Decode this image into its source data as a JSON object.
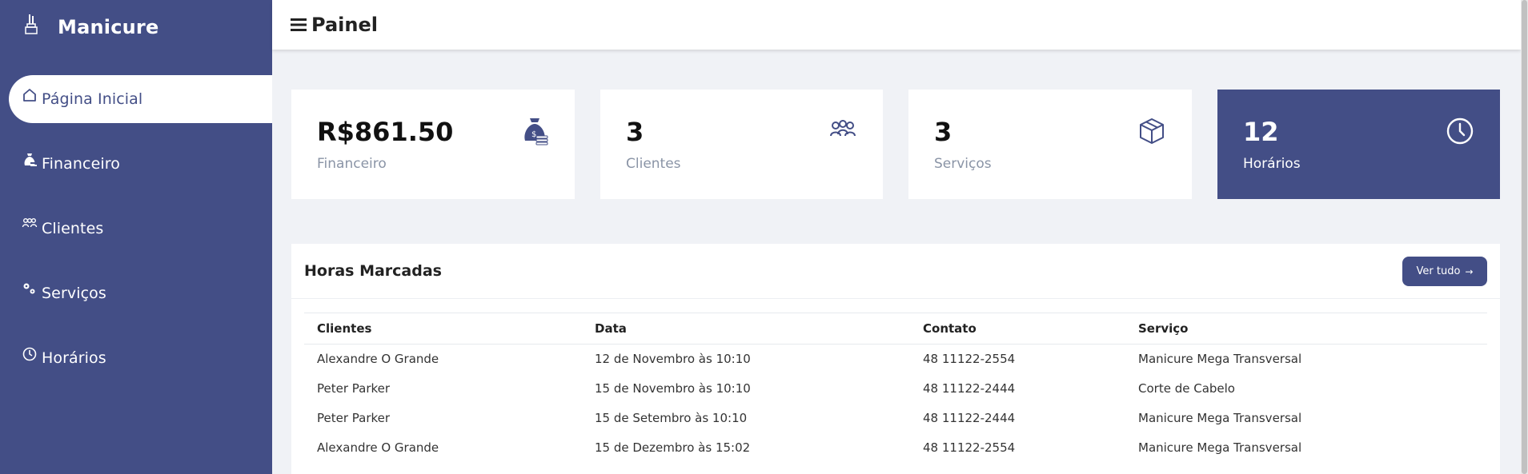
{
  "brand": {
    "name": "Manicure",
    "icon": "nail-polish-icon"
  },
  "sidebar": {
    "items": [
      {
        "label": "Página Inicial",
        "icon": "home-icon",
        "active": true
      },
      {
        "label": "Financeiro",
        "icon": "finance-icon",
        "active": false
      },
      {
        "label": "Clientes",
        "icon": "users-icon",
        "active": false
      },
      {
        "label": "Serviços",
        "icon": "gears-icon",
        "active": false
      },
      {
        "label": "Horários",
        "icon": "clock-icon",
        "active": false
      }
    ]
  },
  "header": {
    "title": "Painel",
    "menu_icon": "hamburger-icon"
  },
  "cards": [
    {
      "value": "R$861.50",
      "label": "Financeiro",
      "icon": "money-bag-icon"
    },
    {
      "value": "3",
      "label": "Clientes",
      "icon": "users-icon"
    },
    {
      "value": "3",
      "label": "Serviços",
      "icon": "box-icon"
    },
    {
      "value": "12",
      "label": "Horários",
      "icon": "clock-icon"
    }
  ],
  "appointments": {
    "title": "Horas Marcadas",
    "button_label": "Ver tudo",
    "columns": [
      "Clientes",
      "Data",
      "Contato",
      "Serviço"
    ],
    "rows": [
      [
        "Alexandre O Grande",
        "12 de Novembro às 10:10",
        "48 11122-2554",
        "Manicure Mega Transversal"
      ],
      [
        "Peter Parker",
        "15 de Novembro às 10:10",
        "48 11122-2444",
        "Corte de Cabelo"
      ],
      [
        "Peter Parker",
        "15 de Setembro às 10:10",
        "48 11122-2444",
        "Manicure Mega Transversal"
      ],
      [
        "Alexandre O Grande",
        "15 de Dezembro às 15:02",
        "48 11122-2554",
        "Manicure Mega Transversal"
      ]
    ]
  },
  "colors": {
    "primary": "#434e86",
    "background": "#f0f2f6"
  }
}
